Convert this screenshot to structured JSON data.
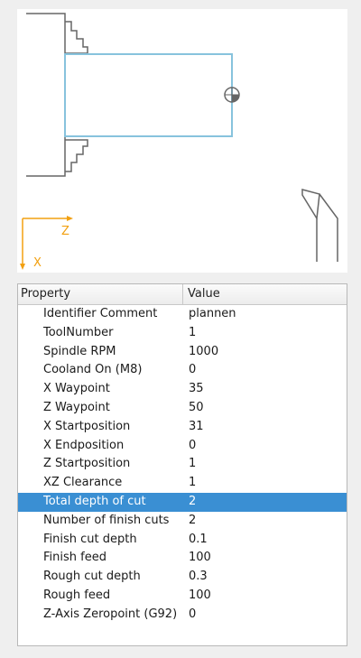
{
  "preview": {
    "axis_z_label": "Z",
    "axis_x_label": "X"
  },
  "table": {
    "headers": {
      "property": "Property",
      "value": "Value"
    },
    "rows": [
      {
        "property": "Identifier Comment",
        "value": "plannen"
      },
      {
        "property": "ToolNumber",
        "value": "1"
      },
      {
        "property": "Spindle RPM",
        "value": "1000"
      },
      {
        "property": "Cooland On (M8)",
        "value": "0"
      },
      {
        "property": "X Waypoint",
        "value": "35"
      },
      {
        "property": "Z Waypoint",
        "value": "50"
      },
      {
        "property": "X Startposition",
        "value": "31"
      },
      {
        "property": "X Endposition",
        "value": "0"
      },
      {
        "property": "Z Startposition",
        "value": "1"
      },
      {
        "property": "XZ Clearance",
        "value": "1"
      },
      {
        "property": "Total depth of cut",
        "value": "2",
        "selected": true
      },
      {
        "property": "Number of finish cuts",
        "value": "2"
      },
      {
        "property": "Finish cut depth",
        "value": "0.1"
      },
      {
        "property": "Finish feed",
        "value": "100"
      },
      {
        "property": "Rough cut depth",
        "value": "0.3"
      },
      {
        "property": "Rough feed",
        "value": "100"
      },
      {
        "property": "Z-Axis Zeropoint (G92)",
        "value": "0"
      }
    ]
  },
  "colors": {
    "axis": "#f2a010",
    "workpiece": "#87c3dd",
    "chuck": "#555555",
    "selection": "#3a8fd3"
  }
}
